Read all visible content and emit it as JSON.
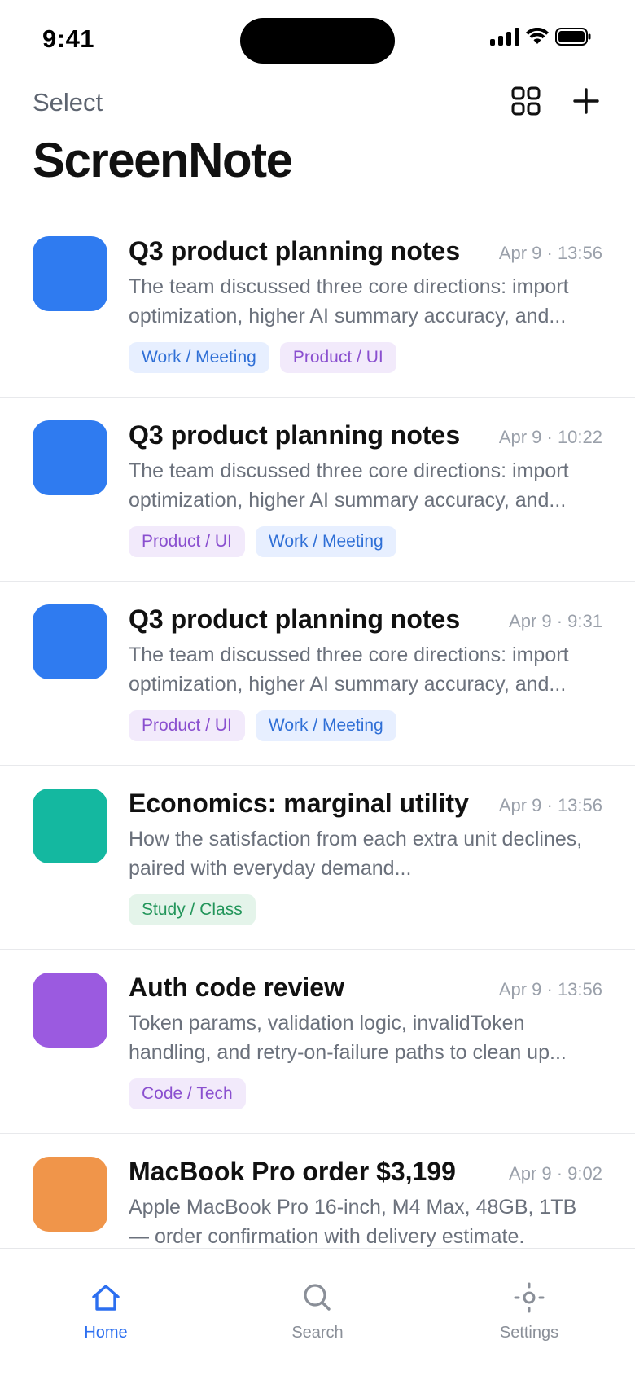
{
  "status_bar": {
    "time": "9:41"
  },
  "header": {
    "select_label": "Select",
    "title": "ScreenNote",
    "grid_icon": "grid-icon",
    "add_icon": "plus-icon"
  },
  "notes": [
    {
      "title": "Q3 product planning notes",
      "time": "Apr 9 · 13:56",
      "description": "The team discussed three core directions: import optimization, higher AI summary accuracy, and...",
      "thumb_color": "#2f7bf0",
      "tags": [
        {
          "label": "Work / Meeting",
          "kind": "work"
        },
        {
          "label": "Product / UI",
          "kind": "product"
        }
      ]
    },
    {
      "title": "Q3 product planning notes",
      "time": "Apr 9 · 10:22",
      "description": "The team discussed three core directions: import optimization, higher AI summary accuracy, and...",
      "thumb_color": "#2f7bf0",
      "tags": [
        {
          "label": "Product / UI",
          "kind": "product"
        },
        {
          "label": "Work / Meeting",
          "kind": "work"
        }
      ]
    },
    {
      "title": "Q3 product planning notes",
      "time": "Apr 9 · 9:31",
      "description": "The team discussed three core directions: import optimization, higher AI summary accuracy, and...",
      "thumb_color": "#2f7bf0",
      "tags": [
        {
          "label": "Product / UI",
          "kind": "product"
        },
        {
          "label": "Work / Meeting",
          "kind": "work"
        }
      ]
    },
    {
      "title": "Economics: marginal utility",
      "time": "Apr 9 · 13:56",
      "description": "How the satisfaction from each extra unit declines, paired with everyday demand...",
      "thumb_color": "#14b8a0",
      "tags": [
        {
          "label": "Study / Class",
          "kind": "study"
        }
      ]
    },
    {
      "title": "Auth code review",
      "time": "Apr 9 · 13:56",
      "description": "Token params, validation logic, invalidToken handling, and retry-on-failure paths to clean up...",
      "thumb_color": "#9b5ae0",
      "tags": [
        {
          "label": "Code / Tech",
          "kind": "code"
        }
      ]
    },
    {
      "title": "MacBook Pro order $3,199",
      "time": "Apr 9 · 9:02",
      "description": "Apple MacBook Pro 16-inch, M4 Max, 48GB, 1TB — order confirmation with delivery estimate.",
      "thumb_color": "#f0954a",
      "tags": []
    }
  ],
  "tab_bar": {
    "home_label": "Home",
    "search_label": "Search",
    "settings_label": "Settings",
    "active_color": "#2c6ff0",
    "inactive_color": "#8a8f98"
  }
}
